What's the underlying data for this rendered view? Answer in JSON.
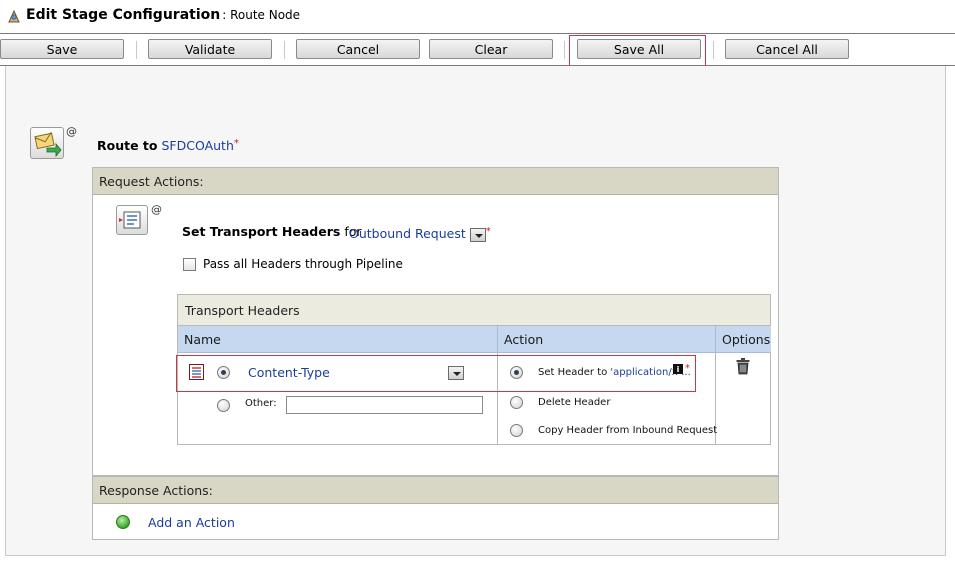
{
  "title": {
    "main": "Edit Stage Configuration",
    "sub": ": Route Node"
  },
  "toolbar": {
    "save": "Save",
    "validate": "Validate",
    "cancel": "Cancel",
    "clear": "Clear",
    "save_all": "Save All",
    "cancel_all": "Cancel All"
  },
  "route": {
    "prefix": "Route to",
    "target": "SFDCOAuth",
    "required": "*",
    "at": "@"
  },
  "request_actions": {
    "label": "Request Actions:",
    "set_transport": {
      "title": "Set Transport Headers",
      "for_word": "for",
      "direction": "Outbound Request",
      "required": "*",
      "at": "@",
      "pass_all_label": "Pass all Headers through Pipeline"
    },
    "transport_headers": {
      "label": "Transport Headers",
      "columns": [
        "Name",
        "Action",
        "Options"
      ],
      "name_value": "Content-Type",
      "other_label": "Other:",
      "actions": [
        {
          "prefix": "Set Header to ",
          "value": "'application/x-...",
          "selected": true,
          "required": "*"
        },
        {
          "prefix": "Delete Header",
          "selected": false
        },
        {
          "prefix": "Copy Header from Inbound Request",
          "selected": false
        }
      ]
    }
  },
  "response_actions": {
    "label": "Response Actions:",
    "add_action": "Add an Action"
  },
  "colors": {
    "highlight": "#d0343c",
    "link": "#1a3d9a",
    "panel_header": "#d8d6c4",
    "column_header": "#c6d8f0"
  },
  "icons": [
    "edit-stage-icon",
    "route-node-icon",
    "transport-headers-icon",
    "list-icon",
    "info-icon",
    "trash-icon",
    "add-action-icon"
  ]
}
